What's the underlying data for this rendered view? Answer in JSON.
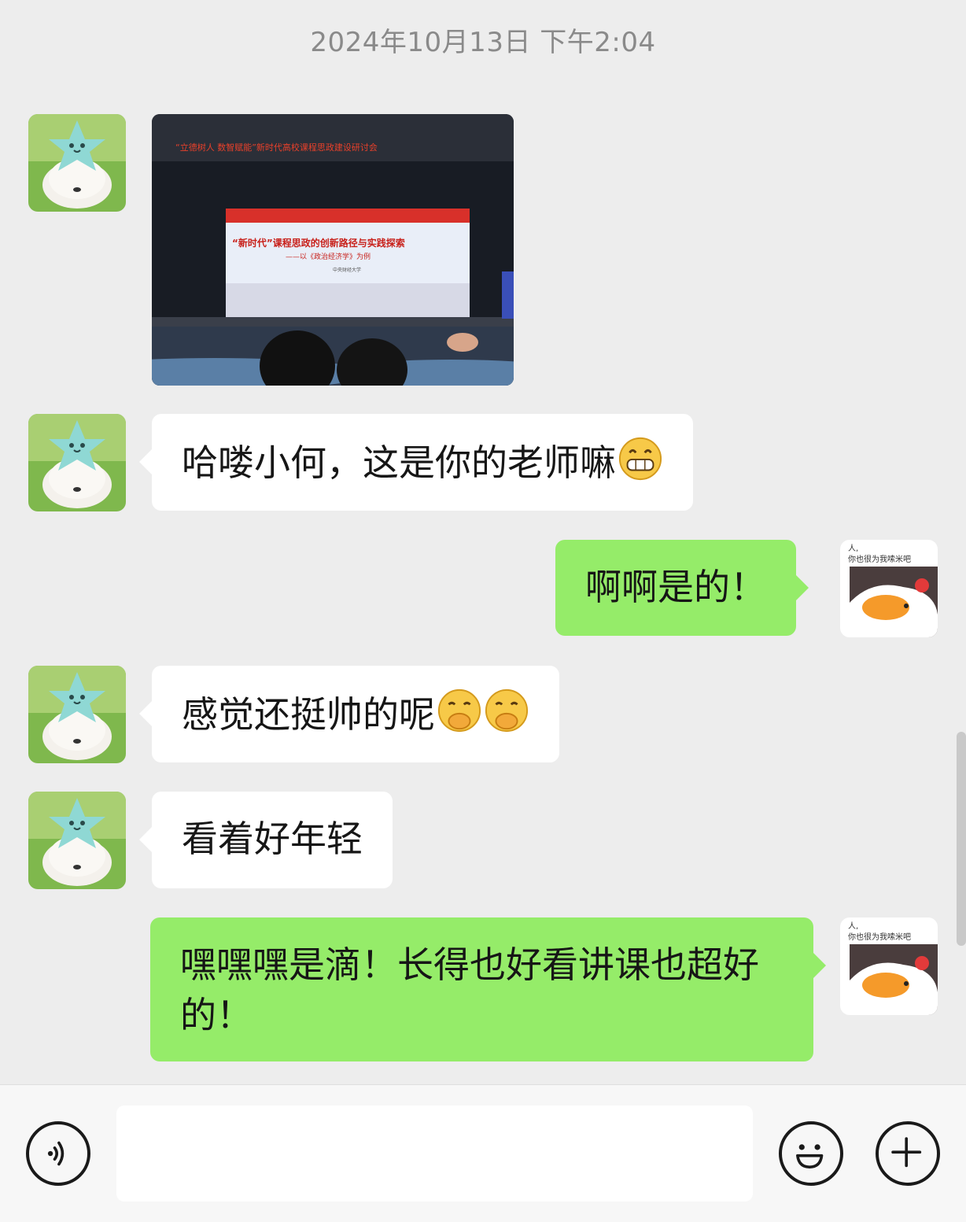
{
  "chat": {
    "timestamp": "2024年10月13日 下午2:04",
    "photo": {
      "banner": "“立德树人 数智赋能”新时代高校课程思政建设研讨会",
      "screen_title": "“新时代”课程思政的创新路径与实践探索",
      "screen_subtitle": "——以《政治经济学》为例",
      "screen_org": "中央财经大学"
    },
    "messages": [
      {
        "side": "in",
        "text": "哈喽小何，这是你的老师嘛",
        "emoji": [
          "grin-icon"
        ]
      },
      {
        "side": "out",
        "text": "啊啊是的！"
      },
      {
        "side": "in",
        "text": "感觉还挺帅的呢",
        "emoji": [
          "shush-icon",
          "shush-icon"
        ]
      },
      {
        "side": "in",
        "text": "看着好年轻"
      },
      {
        "side": "out",
        "text": "嘿嘿嘿是滴！长得也好看讲课也超好的！"
      }
    ],
    "self_avatar_caption": "人,\n你也很为我嗦米吧"
  },
  "input_bar": {
    "voice_icon": "voice-icon",
    "input_value": "",
    "emoji_icon": "smiley-icon",
    "add_icon": "plus-icon"
  },
  "colors": {
    "background": "#ededed",
    "incoming_bubble": "#ffffff",
    "outgoing_bubble": "#95ec69",
    "bottom_bar": "#f7f7f7"
  }
}
